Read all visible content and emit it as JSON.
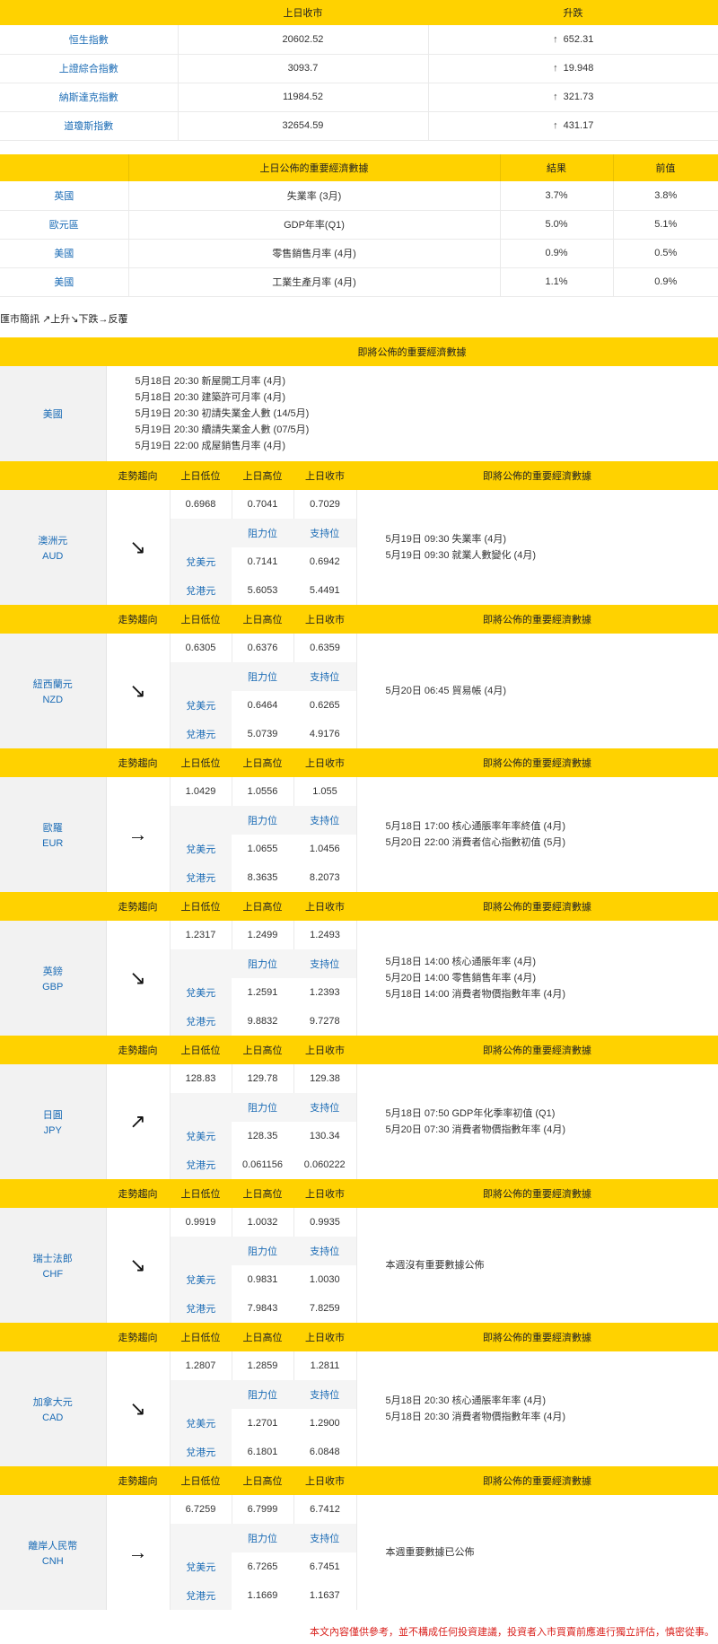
{
  "indices": {
    "headers": [
      "",
      "上日收市",
      "升跌"
    ],
    "rows": [
      {
        "name": "恒生指數",
        "close": "20602.52",
        "change": "652.31",
        "dir": "↑"
      },
      {
        "name": "上證綜合指數",
        "close": "3093.7",
        "change": "19.948",
        "dir": "↑"
      },
      {
        "name": "納斯達克指數",
        "close": "11984.52",
        "change": "321.73",
        "dir": "↑"
      },
      {
        "name": "道瓊斯指數",
        "close": "32654.59",
        "change": "431.17",
        "dir": "↑"
      }
    ]
  },
  "econ_prev": {
    "headers": [
      "",
      "上日公佈的重要經濟數據",
      "結果",
      "前值"
    ],
    "rows": [
      {
        "region": "英國",
        "item": "失業率 (3月)",
        "result": "3.7%",
        "prev": "3.8%"
      },
      {
        "region": "歐元區",
        "item": "GDP年率(Q1)",
        "result": "5.0%",
        "prev": "5.1%"
      },
      {
        "region": "美國",
        "item": "零售銷售月率 (4月)",
        "result": "0.9%",
        "prev": "0.5%"
      },
      {
        "region": "美國",
        "item": "工業生產月率 (4月)",
        "result": "1.1%",
        "prev": "0.9%"
      }
    ]
  },
  "legend": "匯市簡訊 ↗上升↘下跌→反覆",
  "upcoming_us": {
    "header": "即將公佈的重要經濟數據",
    "region": "美國",
    "items": [
      "5月18日 20:30 新屋開工月率 (4月)",
      "5月18日 20:30 建築許可月率 (4月)",
      "5月19日 20:30 初請失業金人數 (14/5月)",
      "5月19日 20:30 續請失業金人數 (07/5月)",
      "5月19日 22:00 成屋銷售月率 (4月)"
    ]
  },
  "fx_headers": {
    "trend": "走勢趨向",
    "low": "上日低位",
    "high": "上日高位",
    "close": "上日收市",
    "events": "即將公佈的重要經濟數據",
    "resistance": "阻力位",
    "support": "支持位",
    "vs_usd": "兌美元",
    "vs_hkd": "兌港元"
  },
  "currencies": [
    {
      "name": "澳洲元",
      "code": "AUD",
      "trend": "↘",
      "low": "0.6968",
      "high": "0.7041",
      "close": "0.7029",
      "usd_res": "0.7141",
      "usd_sup": "0.6942",
      "hkd_res": "5.6053",
      "hkd_sup": "5.4491",
      "events": [
        "5月19日 09:30 失業率 (4月)",
        "5月19日 09:30 就業人數變化 (4月)"
      ]
    },
    {
      "name": "紐西蘭元",
      "code": "NZD",
      "trend": "↘",
      "low": "0.6305",
      "high": "0.6376",
      "close": "0.6359",
      "usd_res": "0.6464",
      "usd_sup": "0.6265",
      "hkd_res": "5.0739",
      "hkd_sup": "4.9176",
      "events": [
        "5月20日 06:45 貿易帳 (4月)"
      ]
    },
    {
      "name": "歐羅",
      "code": "EUR",
      "trend": "→",
      "low": "1.0429",
      "high": "1.0556",
      "close": "1.055",
      "usd_res": "1.0655",
      "usd_sup": "1.0456",
      "hkd_res": "8.3635",
      "hkd_sup": "8.2073",
      "events": [
        "5月18日 17:00 核心通脹率年率終值 (4月)",
        "5月20日 22:00 消費者信心指數初值 (5月)"
      ]
    },
    {
      "name": "英鎊",
      "code": "GBP",
      "trend": "↘",
      "low": "1.2317",
      "high": "1.2499",
      "close": "1.2493",
      "usd_res": "1.2591",
      "usd_sup": "1.2393",
      "hkd_res": "9.8832",
      "hkd_sup": "9.7278",
      "events": [
        "5月18日 14:00 核心通脹年率 (4月)",
        "5月20日 14:00 零售銷售年率 (4月)",
        "5月18日 14:00 消費者物價指數年率 (4月)"
      ]
    },
    {
      "name": "日圓",
      "code": "JPY",
      "trend": "↗",
      "low": "128.83",
      "high": "129.78",
      "close": "129.38",
      "usd_res": "128.35",
      "usd_sup": "130.34",
      "hkd_res": "0.061156",
      "hkd_sup": "0.060222",
      "events": [
        "5月18日 07:50 GDP年化季率初值 (Q1)",
        "5月20日 07:30 消費者物價指數年率 (4月)"
      ]
    },
    {
      "name": "瑞士法郎",
      "code": "CHF",
      "trend": "↘",
      "low": "0.9919",
      "high": "1.0032",
      "close": "0.9935",
      "usd_res": "0.9831",
      "usd_sup": "1.0030",
      "hkd_res": "7.9843",
      "hkd_sup": "7.8259",
      "events": [
        "本週沒有重要數據公佈"
      ]
    },
    {
      "name": "加拿大元",
      "code": "CAD",
      "trend": "↘",
      "low": "1.2807",
      "high": "1.2859",
      "close": "1.2811",
      "usd_res": "1.2701",
      "usd_sup": "1.2900",
      "hkd_res": "6.1801",
      "hkd_sup": "6.0848",
      "events": [
        "5月18日 20:30 核心通脹率年率 (4月)",
        "5月18日 20:30 消費者物價指數年率 (4月)"
      ]
    },
    {
      "name": "離岸人民幣",
      "code": "CNH",
      "trend": "→",
      "low": "6.7259",
      "high": "6.7999",
      "close": "6.7412",
      "usd_res": "6.7265",
      "usd_sup": "6.7451",
      "hkd_res": "1.1669",
      "hkd_sup": "1.1637",
      "events": [
        "本週重要數據已公佈"
      ]
    }
  ],
  "disclaimer": "本文內容僅供參考，並不構成任何投資建議，投資者入市買賣前應進行獨立評估，慎密從事。"
}
